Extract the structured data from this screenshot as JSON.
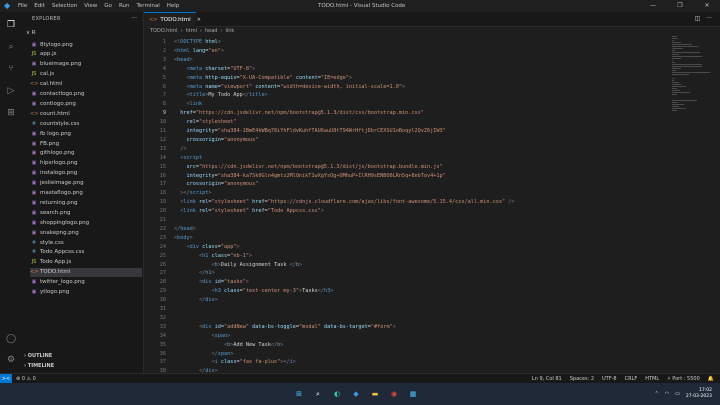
{
  "titlebar": {
    "menu": [
      "File",
      "Edit",
      "Selection",
      "View",
      "Go",
      "Run",
      "Terminal",
      "Help"
    ],
    "title": "TODO.html - Visual Studio Code",
    "controls": [
      "—",
      "❐",
      "✕"
    ]
  },
  "sidebar": {
    "header": "EXPLORER",
    "more": "···",
    "folder": "∨ R",
    "files": [
      {
        "name": "8tylogo.png",
        "icon": "▣",
        "color": "#a074c4"
      },
      {
        "name": "app.js",
        "icon": "JS",
        "color": "#cbcb41"
      },
      {
        "name": "blueimage.png",
        "icon": "▣",
        "color": "#a074c4"
      },
      {
        "name": "cal.js",
        "icon": "JS",
        "color": "#cbcb41"
      },
      {
        "name": "cal.html",
        "icon": "<>",
        "color": "#e37933"
      },
      {
        "name": "contactlogo.png",
        "icon": "▣",
        "color": "#a074c4"
      },
      {
        "name": "contlogo.png",
        "icon": "▣",
        "color": "#a074c4"
      },
      {
        "name": "count.html",
        "icon": "<>",
        "color": "#e37933"
      },
      {
        "name": "countstyle.css",
        "icon": "#",
        "color": "#519aba"
      },
      {
        "name": "fb logo.png",
        "icon": "▣",
        "color": "#a074c4"
      },
      {
        "name": "FB.png",
        "icon": "▣",
        "color": "#a074c4"
      },
      {
        "name": "githlogo.png",
        "icon": "▣",
        "color": "#a074c4"
      },
      {
        "name": "hipsrlogo.png",
        "icon": "▣",
        "color": "#a074c4"
      },
      {
        "name": "instalogo.png",
        "icon": "▣",
        "color": "#a074c4"
      },
      {
        "name": "jeslieimage.png",
        "icon": "▣",
        "color": "#a074c4"
      },
      {
        "name": "mastaflogo.png",
        "icon": "▣",
        "color": "#a074c4"
      },
      {
        "name": "returning.png",
        "icon": "▣",
        "color": "#a074c4"
      },
      {
        "name": "search.png",
        "icon": "▣",
        "color": "#a074c4"
      },
      {
        "name": "shoppinglogo.png",
        "icon": "▣",
        "color": "#a074c4"
      },
      {
        "name": "snakepng.png",
        "icon": "▣",
        "color": "#a074c4"
      },
      {
        "name": "style.css",
        "icon": "#",
        "color": "#519aba"
      },
      {
        "name": "Todo Appcss.css",
        "icon": "#",
        "color": "#519aba"
      },
      {
        "name": "Todo App.js",
        "icon": "JS",
        "color": "#cbcb41"
      },
      {
        "name": "TODO.html",
        "icon": "<>",
        "color": "#e37933",
        "selected": true
      },
      {
        "name": "twitter_logo.png",
        "icon": "▣",
        "color": "#a074c4"
      },
      {
        "name": "ytlogo.png",
        "icon": "▣",
        "color": "#a074c4"
      }
    ],
    "outline": "› OUTLINE",
    "timeline": "› TIMELINE"
  },
  "tab": {
    "label": "TODO.html",
    "close": "✕"
  },
  "breadcrumb": [
    "TODO.html",
    "›",
    "html",
    "›",
    "head",
    "›",
    "link"
  ],
  "editor": {
    "current_line": 9,
    "lines": [
      [
        [
          "t",
          "<!"
        ],
        [
          "tg",
          "DOCTYPE"
        ],
        [
          "at",
          " html"
        ],
        [
          "t",
          ">"
        ]
      ],
      [
        [
          "t",
          "<"
        ],
        [
          "tg",
          "html"
        ],
        [
          "at",
          " lang"
        ],
        [
          "tx",
          "="
        ],
        [
          "st",
          "\"en\""
        ],
        [
          "t",
          ">"
        ]
      ],
      [
        [
          "t",
          "<"
        ],
        [
          "tg",
          "head"
        ],
        [
          "t",
          ">"
        ]
      ],
      [
        [
          "tx",
          "    "
        ],
        [
          "t",
          "<"
        ],
        [
          "tg",
          "meta"
        ],
        [
          "at",
          " charset"
        ],
        [
          "tx",
          "="
        ],
        [
          "st",
          "\"UTF-8\""
        ],
        [
          "t",
          ">"
        ]
      ],
      [
        [
          "tx",
          "    "
        ],
        [
          "t",
          "<"
        ],
        [
          "tg",
          "meta"
        ],
        [
          "at",
          " http-equiv"
        ],
        [
          "tx",
          "="
        ],
        [
          "st",
          "\"X-UA-Compatible\""
        ],
        [
          "at",
          " content"
        ],
        [
          "tx",
          "="
        ],
        [
          "st",
          "\"IE=edge\""
        ],
        [
          "t",
          ">"
        ]
      ],
      [
        [
          "tx",
          "    "
        ],
        [
          "t",
          "<"
        ],
        [
          "tg",
          "meta"
        ],
        [
          "at",
          " name"
        ],
        [
          "tx",
          "="
        ],
        [
          "st",
          "\"viewport\""
        ],
        [
          "at",
          " content"
        ],
        [
          "tx",
          "="
        ],
        [
          "st",
          "\"width=device-width, initial-scale=1.0\""
        ],
        [
          "t",
          ">"
        ]
      ],
      [
        [
          "tx",
          "    "
        ],
        [
          "t",
          "<"
        ],
        [
          "tg",
          "title"
        ],
        [
          "t",
          ">"
        ],
        [
          "tx",
          "My Todo App"
        ],
        [
          "t",
          "</"
        ],
        [
          "tg",
          "title"
        ],
        [
          "t",
          ">"
        ]
      ],
      [
        [
          "tx",
          "    "
        ],
        [
          "t",
          "<"
        ],
        [
          "tg",
          "link"
        ]
      ],
      [
        [
          "at",
          "  href"
        ],
        [
          "tx",
          "="
        ],
        [
          "st",
          "\"https://cdn.jsdelivr.net/npm/bootstrap@5.1.3/dist/css/bootstrap.min.css\""
        ]
      ],
      [
        [
          "at",
          "    rel"
        ],
        [
          "tx",
          "="
        ],
        [
          "st",
          "\"stylesheet\""
        ]
      ],
      [
        [
          "at",
          "    integrity"
        ],
        [
          "tx",
          "="
        ],
        [
          "st",
          "\"sha384-1BmE4kWBq78iYhFldvKuhfTAU6auU8tT94WrHftjDbrCEXSU1oBoqyl2QvZ6jIW3\""
        ]
      ],
      [
        [
          "at",
          "    crossorigin"
        ],
        [
          "tx",
          "="
        ],
        [
          "st",
          "\"anonymous\""
        ]
      ],
      [
        [
          "tx",
          "  "
        ],
        [
          "t",
          "/>"
        ]
      ],
      [
        [
          "tx",
          "  "
        ],
        [
          "t",
          "<"
        ],
        [
          "tg",
          "script"
        ]
      ],
      [
        [
          "at",
          "    src"
        ],
        [
          "tx",
          "="
        ],
        [
          "st",
          "\"https://cdn.jsdelivr.net/npm/bootstrap@5.1.3/dist/js/bootstrap.bundle.min.js\""
        ]
      ],
      [
        [
          "at",
          "    integrity"
        ],
        [
          "tx",
          "="
        ],
        [
          "st",
          "\"sha384-ka7Sk0Gln4gmtz2MlQnikT1wXgYsOg+OMhuP+IlRH9sENBO0LRn5q+8nbTov4+1p\""
        ]
      ],
      [
        [
          "at",
          "    crossorigin"
        ],
        [
          "tx",
          "="
        ],
        [
          "st",
          "\"anonymous\""
        ]
      ],
      [
        [
          "tx",
          "  "
        ],
        [
          "t",
          "></"
        ],
        [
          "tg",
          "script"
        ],
        [
          "t",
          ">"
        ]
      ],
      [
        [
          "tx",
          "  "
        ],
        [
          "t",
          "<"
        ],
        [
          "tg",
          "link"
        ],
        [
          "at",
          " rel"
        ],
        [
          "tx",
          "="
        ],
        [
          "st",
          "\"stylesheet\""
        ],
        [
          "at",
          " href"
        ],
        [
          "tx",
          "="
        ],
        [
          "st",
          "\"https://cdnjs.cloudflare.com/ajax/libs/font-awesome/5.15.4/css/all.min.css\""
        ],
        [
          "t",
          " />"
        ]
      ],
      [
        [
          "tx",
          "  "
        ],
        [
          "t",
          "<"
        ],
        [
          "tg",
          "link"
        ],
        [
          "at",
          " rel"
        ],
        [
          "tx",
          "="
        ],
        [
          "st",
          "\"stylesheet\""
        ],
        [
          "at",
          " href"
        ],
        [
          "tx",
          "="
        ],
        [
          "st",
          "\"Todo Appcss.css\""
        ],
        [
          "t",
          ">"
        ]
      ],
      [
        [
          "tx",
          ""
        ]
      ],
      [
        [
          "t",
          "</"
        ],
        [
          "tg",
          "head"
        ],
        [
          "t",
          ">"
        ]
      ],
      [
        [
          "t",
          "<"
        ],
        [
          "tg",
          "body"
        ],
        [
          "t",
          ">"
        ]
      ],
      [
        [
          "tx",
          "    "
        ],
        [
          "t",
          "<"
        ],
        [
          "tg",
          "div"
        ],
        [
          "at",
          " class"
        ],
        [
          "tx",
          "="
        ],
        [
          "st",
          "\"app\""
        ],
        [
          "t",
          ">"
        ]
      ],
      [
        [
          "tx",
          "        "
        ],
        [
          "t",
          "<"
        ],
        [
          "tg",
          "h1"
        ],
        [
          "at",
          " class"
        ],
        [
          "tx",
          "="
        ],
        [
          "st",
          "\"nb-1\""
        ],
        [
          "t",
          ">"
        ]
      ],
      [
        [
          "tx",
          "            "
        ],
        [
          "t",
          "<"
        ],
        [
          "tg",
          "b"
        ],
        [
          "t",
          ">"
        ],
        [
          "tx",
          "Daily Assignment Task "
        ],
        [
          "t",
          "</"
        ],
        [
          "tg",
          "b"
        ],
        [
          "t",
          ">"
        ]
      ],
      [
        [
          "tx",
          "        "
        ],
        [
          "t",
          "</"
        ],
        [
          "tg",
          "h1"
        ],
        [
          "t",
          ">"
        ]
      ],
      [
        [
          "tx",
          "        "
        ],
        [
          "t",
          "<"
        ],
        [
          "tg",
          "div"
        ],
        [
          "at",
          " id"
        ],
        [
          "tx",
          "="
        ],
        [
          "st",
          "\"tasks\""
        ],
        [
          "t",
          ">"
        ]
      ],
      [
        [
          "tx",
          "            "
        ],
        [
          "t",
          "<"
        ],
        [
          "tg",
          "h3"
        ],
        [
          "at",
          " class"
        ],
        [
          "tx",
          "="
        ],
        [
          "st",
          "\"text-center my-3\""
        ],
        [
          "t",
          ">"
        ],
        [
          "tx",
          "Tasks"
        ],
        [
          "t",
          "</"
        ],
        [
          "tg",
          "h3"
        ],
        [
          "t",
          ">"
        ]
      ],
      [
        [
          "tx",
          "        "
        ],
        [
          "t",
          "</"
        ],
        [
          "tg",
          "div"
        ],
        [
          "t",
          ">"
        ]
      ],
      [
        [
          "tx",
          ""
        ]
      ],
      [
        [
          "tx",
          ""
        ]
      ],
      [
        [
          "tx",
          "        "
        ],
        [
          "t",
          "<"
        ],
        [
          "tg",
          "div"
        ],
        [
          "at",
          " id"
        ],
        [
          "tx",
          "="
        ],
        [
          "st",
          "\"addNew\""
        ],
        [
          "at",
          " data-bs-toggle"
        ],
        [
          "tx",
          "="
        ],
        [
          "st",
          "\"modal\""
        ],
        [
          "at",
          " data-bs-target"
        ],
        [
          "tx",
          "="
        ],
        [
          "st",
          "\"#form\""
        ],
        [
          "t",
          ">"
        ]
      ],
      [
        [
          "tx",
          "            "
        ],
        [
          "t",
          "<"
        ],
        [
          "tg",
          "span"
        ],
        [
          "t",
          ">"
        ]
      ],
      [
        [
          "tx",
          "                "
        ],
        [
          "t",
          "<"
        ],
        [
          "tg",
          "b"
        ],
        [
          "t",
          ">"
        ],
        [
          "tx",
          "Add New Task"
        ],
        [
          "t",
          "</"
        ],
        [
          "tg",
          "b"
        ],
        [
          "t",
          ">"
        ]
      ],
      [
        [
          "tx",
          "            "
        ],
        [
          "t",
          "</"
        ],
        [
          "tg",
          "span"
        ],
        [
          "t",
          ">"
        ]
      ],
      [
        [
          "tx",
          "            "
        ],
        [
          "t",
          "<"
        ],
        [
          "tg",
          "i"
        ],
        [
          "at",
          " class"
        ],
        [
          "tx",
          "="
        ],
        [
          "st",
          "\"fas fa-plus\""
        ],
        [
          "t",
          "></"
        ],
        [
          "tg",
          "i"
        ],
        [
          "t",
          ">"
        ]
      ],
      [
        [
          "tx",
          "        "
        ],
        [
          "t",
          "</"
        ],
        [
          "tg",
          "div"
        ],
        [
          "t",
          ">"
        ]
      ]
    ]
  },
  "status": {
    "remote": "><",
    "left": [
      "⊗ 0 ⚠ 0"
    ],
    "right": [
      "Ln 9, Col 81",
      "Spaces: 2",
      "UTF-8",
      "CRLF",
      "HTML",
      "⚡ Port : 5500",
      "🔔"
    ]
  },
  "taskbar": {
    "icons": [
      {
        "name": "windows-start-icon",
        "glyph": "⊞",
        "color": "#4cc2ff"
      },
      {
        "name": "search-icon",
        "glyph": "⌕",
        "color": "#ffffff"
      },
      {
        "name": "edge-icon",
        "glyph": "◐",
        "color": "#36c9a0"
      },
      {
        "name": "vscode-icon",
        "glyph": "◆",
        "color": "#3c9be6"
      },
      {
        "name": "file-explorer-icon",
        "glyph": "▬",
        "color": "#f5c542"
      },
      {
        "name": "chrome-icon",
        "glyph": "◉",
        "color": "#e8453c"
      },
      {
        "name": "store-icon",
        "glyph": "▦",
        "color": "#4cc2ff"
      }
    ],
    "time": "17:02",
    "date": "27-03-2023"
  }
}
